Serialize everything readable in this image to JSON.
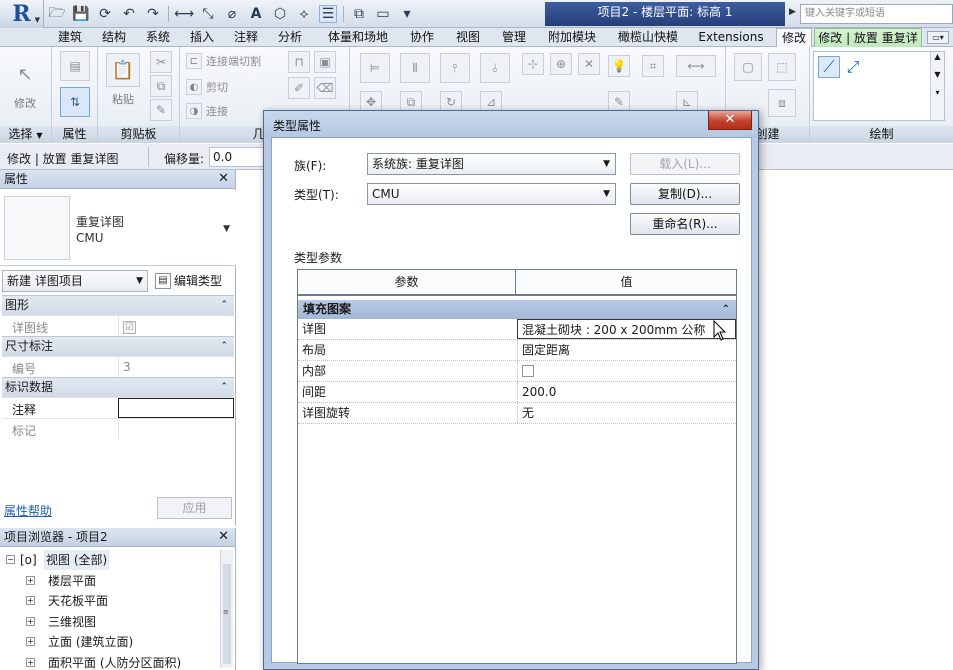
{
  "titlebar": {
    "app_logo": "R",
    "doc_title": "项目2 - 楼层平面: 标高 1",
    "search_placeholder": "键入关键字或短语",
    "qat_text_tool": "A"
  },
  "ribbon_tabs": [
    {
      "label": "建筑"
    },
    {
      "label": "结构"
    },
    {
      "label": "系统"
    },
    {
      "label": "插入"
    },
    {
      "label": "注释"
    },
    {
      "label": "分析"
    },
    {
      "label": "体量和场地"
    },
    {
      "label": "协作"
    },
    {
      "label": "视图"
    },
    {
      "label": "管理"
    },
    {
      "label": "附加模块"
    },
    {
      "label": "橄榄山快模"
    },
    {
      "label": "Extensions"
    },
    {
      "label": "修改"
    },
    {
      "label": "修改 | 放置 重复详图"
    }
  ],
  "ribbon": {
    "modify_label": "修改",
    "paste_label": "粘贴",
    "join_cut_label": "连接端切割",
    "cut_label": "剪切",
    "join_label": "连接",
    "panels": {
      "select": "选择",
      "properties": "属性",
      "clipboard": "剪贴板",
      "geometry": "几何",
      "create": "创建",
      "draw": "绘制"
    }
  },
  "options_bar": {
    "context": "修改 | 放置 重复详图",
    "offset_label": "偏移量:",
    "offset_value": "0.0"
  },
  "properties": {
    "title": "属性",
    "type_name_line1": "重复详图",
    "type_name_line2": "CMU",
    "instance_selector": "新建 详图项目",
    "edit_type": "编辑类型",
    "groups": [
      {
        "name": "图形",
        "rows": [
          {
            "name": "详图线",
            "value": "☑"
          }
        ]
      },
      {
        "name": "尺寸标注",
        "rows": [
          {
            "name": "编号",
            "value": "3"
          }
        ]
      },
      {
        "name": "标识数据",
        "rows": [
          {
            "name": "注释",
            "value": ""
          },
          {
            "name": "标记",
            "value": ""
          }
        ]
      }
    ],
    "help_link": "属性帮助",
    "apply": "应用"
  },
  "browser": {
    "title": "项目浏览器 - 项目2",
    "root": "视图 (全部)",
    "nodes": [
      {
        "label": "楼层平面"
      },
      {
        "label": "天花板平面"
      },
      {
        "label": "三维视图"
      },
      {
        "label": "立面 (建筑立面)"
      },
      {
        "label": "面积平面 (人防分区面积)"
      }
    ]
  },
  "dialog": {
    "title": "类型属性",
    "family_label": "族(F):",
    "family_value": "系统族: 重复详图",
    "type_label": "类型(T):",
    "type_value": "CMU",
    "load_btn": "载入(L)...",
    "duplicate_btn": "复制(D)...",
    "rename_btn": "重命名(R)...",
    "section_label": "类型参数",
    "col_param": "参数",
    "col_value": "值",
    "group": "填充图案",
    "rows": [
      {
        "name": "详图",
        "value": "混凝土砌块 : 200 x 200mm 公称"
      },
      {
        "name": "布局",
        "value": "固定距离"
      },
      {
        "name": "内部",
        "value": ""
      },
      {
        "name": "间距",
        "value": "200.0"
      },
      {
        "name": "详图旋转",
        "value": "无"
      }
    ]
  },
  "colors": {
    "accent_blue": "#1f4f95",
    "dialog_frame": "#b9cbe4",
    "close_red": "#c4422c",
    "title_dark": "#243f7a"
  }
}
